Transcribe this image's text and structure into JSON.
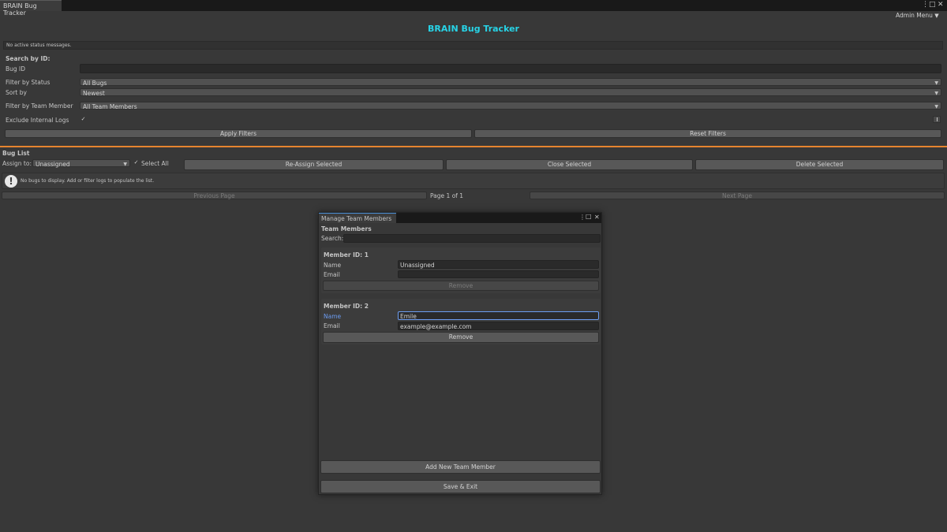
{
  "window": {
    "tab_label": "BRAIN Bug Tracker",
    "menu_icon": "⋮",
    "maximize_icon": "□",
    "close_icon": "✕"
  },
  "header": {
    "admin_menu_label": "Admin Menu",
    "title": "BRAIN Bug Tracker"
  },
  "status": {
    "message": "No active status messages."
  },
  "search": {
    "section_label": "Search by ID:",
    "bug_id_label": "Bug ID",
    "bug_id_value": ""
  },
  "filters": {
    "status_label": "Filter by Status",
    "status_value": "All Bugs",
    "sort_label": "Sort by",
    "sort_value": "Newest",
    "team_member_label": "Filter by Team Member",
    "team_member_value": "All Team Members",
    "exclude_internal_label": "Exclude Internal Logs",
    "exclude_internal_checked": "✓",
    "apply_label": "Apply Filters",
    "reset_label": "Reset Filters"
  },
  "bug_list": {
    "section_label": "Bug List",
    "assign_label": "Assign to:",
    "assign_value": "Unassigned",
    "select_all_label": "Select All",
    "select_all_checked": "✓",
    "reassign_label": "Re-Assign Selected",
    "close_label": "Close Selected",
    "delete_label": "Delete Selected",
    "empty_message": "No bugs to display. Add or filter logs to populate the list.",
    "prev_label": "Previous Page",
    "page_label": "Page 1 of 1",
    "next_label": "Next Page"
  },
  "dialog": {
    "tab_label": "Manage Team Members",
    "section_label": "Team Members",
    "search_label": "Search:",
    "search_value": "",
    "members": [
      {
        "heading": "Member ID: 1",
        "name_label": "Name",
        "name_value": "Unassigned",
        "email_label": "Email",
        "email_value": "",
        "remove_label": "Remove"
      },
      {
        "heading": "Member ID: 2",
        "name_label": "Name",
        "name_value": "Emile",
        "email_label": "Email",
        "email_value": "example@example.com",
        "remove_label": "Remove"
      }
    ],
    "add_label": "Add New Team Member",
    "save_label": "Save & Exit"
  },
  "colors": {
    "title": "#27d3e6",
    "separator": "#e6842f",
    "focus": "#6c9cf0"
  }
}
